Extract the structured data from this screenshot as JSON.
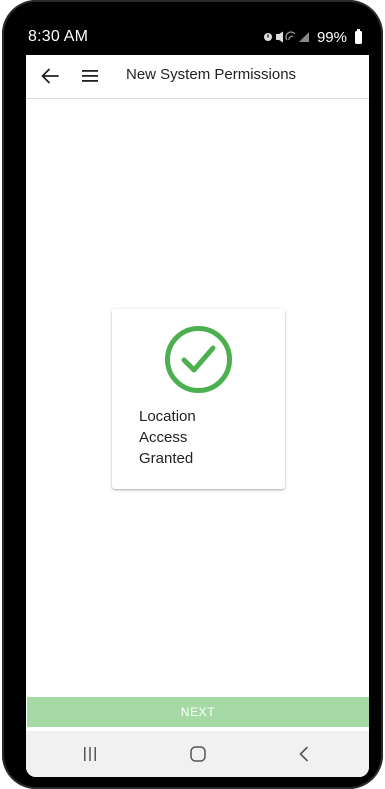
{
  "status_bar": {
    "time": "8:30 AM",
    "indicators": "⏰ 🔇 ◉ ◢",
    "battery_percent": "99%"
  },
  "app_bar": {
    "back_icon": "arrow-left-icon",
    "menu_icon": "hamburger-menu-icon",
    "title": "New System Permissions"
  },
  "card": {
    "icon": "check-circle-icon",
    "icon_color": "#4caf50",
    "line1": "Location",
    "line2": "Access",
    "line3": "Granted"
  },
  "next_button": {
    "label": "NEXT",
    "color": "#a6d9a6",
    "enabled": false
  },
  "nav_bar": {
    "recents_icon": "recents-icon",
    "home_icon": "home-icon",
    "back_icon": "back-chevron-icon"
  }
}
